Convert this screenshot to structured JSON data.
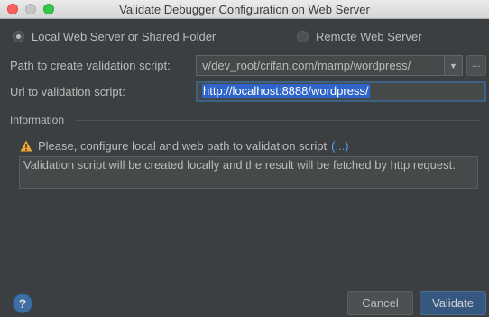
{
  "window": {
    "title": "Validate Debugger Configuration on Web Server"
  },
  "mode": {
    "local_label": "Local Web Server or Shared Folder",
    "remote_label": "Remote Web Server",
    "selected": "local"
  },
  "path": {
    "label": "Path to create validation script:",
    "value": "v/dev_root/crifan.com/mamp/wordpress/",
    "browse_label": "..."
  },
  "url": {
    "label": "Url to validation script:",
    "value": "http://localhost:8888/wordpress/"
  },
  "information": {
    "header": "Information",
    "warning": "Please, configure local and web path to validation script",
    "more_link": "(...)",
    "message": "Validation script will be created locally and the result will be fetched by http request."
  },
  "buttons": {
    "help": "?",
    "cancel": "Cancel",
    "validate": "Validate"
  },
  "colors": {
    "background": "#3c3f41",
    "accent": "#365880",
    "link": "#589df6",
    "selection": "#2f65ca"
  }
}
